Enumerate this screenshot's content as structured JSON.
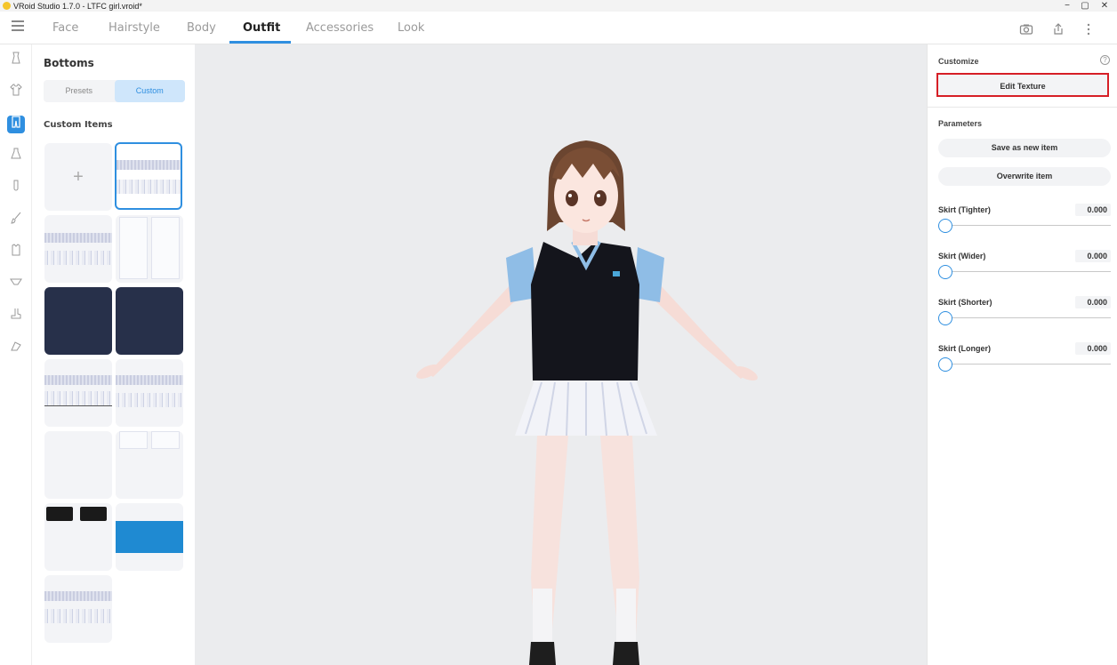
{
  "window": {
    "title": "VRoid Studio 1.7.0 - LTFC girl.vroid*",
    "minimize": "−",
    "restore": "▢",
    "close": "✕"
  },
  "tabs": [
    {
      "label": "Face"
    },
    {
      "label": "Hairstyle"
    },
    {
      "label": "Body"
    },
    {
      "label": "Outfit"
    },
    {
      "label": "Accessories"
    },
    {
      "label": "Look"
    }
  ],
  "active_tab": "Outfit",
  "left_panel": {
    "title": "Bottoms",
    "segment": {
      "presets": "Presets",
      "custom": "Custom",
      "selected": "Custom"
    },
    "section_title": "Custom Items",
    "add_glyph": "+"
  },
  "right_panel": {
    "customize_label": "Customize",
    "help_glyph": "?",
    "edit_texture": "Edit Texture",
    "parameters_label": "Parameters",
    "save_as_new": "Save as new item",
    "overwrite": "Overwrite item",
    "params": [
      {
        "name": "Skirt (Tighter)",
        "value": "0.000",
        "level": 0
      },
      {
        "name": "Skirt (Wider)",
        "value": "0.000",
        "level": 0
      },
      {
        "name": "Skirt (Shorter)",
        "value": "0.000",
        "level": 0
      },
      {
        "name": "Skirt (Longer)",
        "value": "0.000",
        "level": 0
      }
    ]
  },
  "colors": {
    "accent": "#2f8fe0",
    "highlight_box": "#d61f26",
    "viewport_bg": "#ebecee"
  },
  "icons": {
    "menu": "hamburger-icon",
    "camera": "camera-icon",
    "export": "export-icon",
    "more": "more-vertical-icon"
  }
}
